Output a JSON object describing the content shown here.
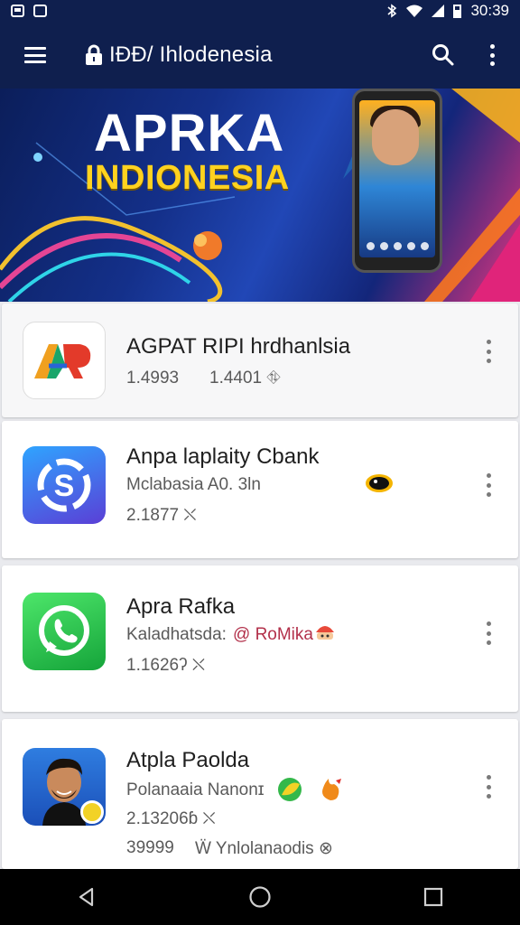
{
  "status_bar": {
    "time": "30:39"
  },
  "app_bar": {
    "title": "IÐÐ/ Ihlodenesia"
  },
  "banner": {
    "title": "APRKA",
    "subtitle": "INDIONESIA"
  },
  "apps": [
    {
      "title": "AGPAT RIPI hrdhanlsia",
      "line1_a": "1.4993",
      "line1_b": "1.4401 ⛗"
    },
    {
      "title": "Anpa laplaity Cbank",
      "line1": "Mclabasia A0. 3ln",
      "line2": "2.1877 ⛌"
    },
    {
      "title": "Apra Rafka",
      "line1_a": "Kaladhatsda:",
      "line1_b": "@ RoMika",
      "line2": "1.1626ʔ ⛌"
    },
    {
      "title": "Atpla Paolda",
      "line1": "Polanaaia Nanonɪ",
      "line2": "2.13206ɓ ⛌",
      "line3_a": "39999",
      "line3_b": "Ẅ Ynlolanaodis ⊗"
    }
  ],
  "colors": {
    "primary_dark": "#0f1f4e",
    "banner_yellow": "#ffd21f",
    "accent": "#b2304a"
  }
}
